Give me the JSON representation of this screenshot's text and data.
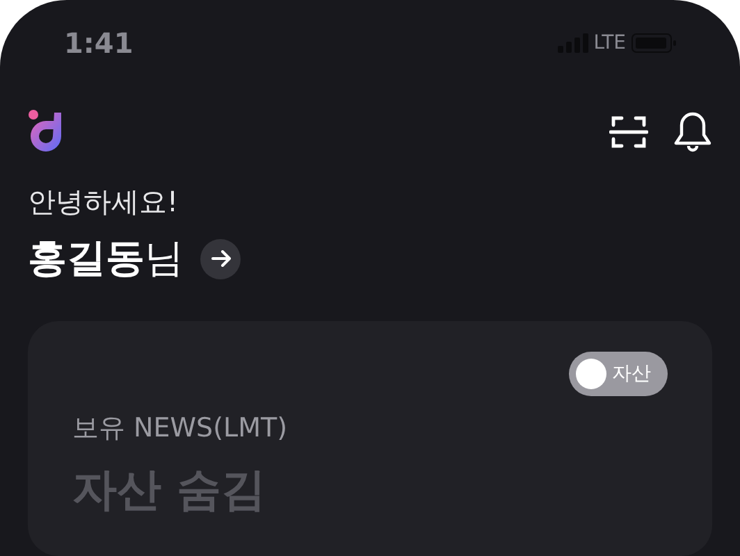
{
  "status_bar": {
    "time": "1:41",
    "network": "LTE"
  },
  "greeting": "안녕하세요!",
  "user": {
    "name": "홍길동",
    "suffix": "님"
  },
  "asset_card": {
    "toggle": {
      "label": "자산",
      "on": false
    },
    "label": "보유 NEWS(LMT)",
    "value": "자산 숨김"
  }
}
